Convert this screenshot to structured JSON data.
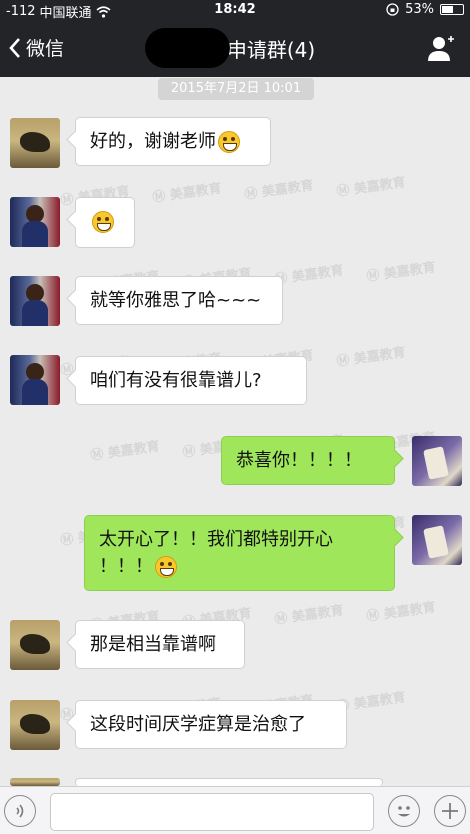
{
  "status_bar": {
    "signal": "-112",
    "carrier": "中国联通",
    "time": "18:42",
    "battery": "53%",
    "battery_level": 0.53
  },
  "nav": {
    "back_label": "微信",
    "title": "申请群(4)"
  },
  "timestamp": "2015年7月2日 10:01",
  "watermark": "美嘉教育",
  "messages": [
    {
      "side": "left",
      "text": "好的，谢谢老师",
      "emoji": "grin-emoji"
    },
    {
      "side": "left",
      "text": "",
      "emoji": "grin-emoji"
    },
    {
      "side": "left",
      "text": "就等你雅思了哈~~~",
      "emoji": null
    },
    {
      "side": "left",
      "text": "咱们有没有很靠谱儿?",
      "emoji": null
    },
    {
      "side": "right",
      "text": "恭喜你！！！！",
      "emoji": null
    },
    {
      "side": "right",
      "text": "太开心了！！我们都特别开心",
      "text2": "！！！",
      "emoji": "grin-emoji"
    },
    {
      "side": "left",
      "text": "那是相当靠谱啊",
      "emoji": null
    },
    {
      "side": "left",
      "text": "这段时间厌学症算是治愈了",
      "emoji": null
    }
  ],
  "icons": {
    "wifi": "wifi-icon",
    "lock_rotation": "rotation-lock-icon",
    "back": "chevron-left-icon",
    "contact": "person-icon",
    "voice": "voice-icon",
    "emoji": "smiley-icon",
    "plus": "plus-icon"
  },
  "colors": {
    "bar": "#222428",
    "background": "#ebebeb",
    "bubble_sent": "#9fe65a",
    "bubble_received": "#ffffff"
  }
}
